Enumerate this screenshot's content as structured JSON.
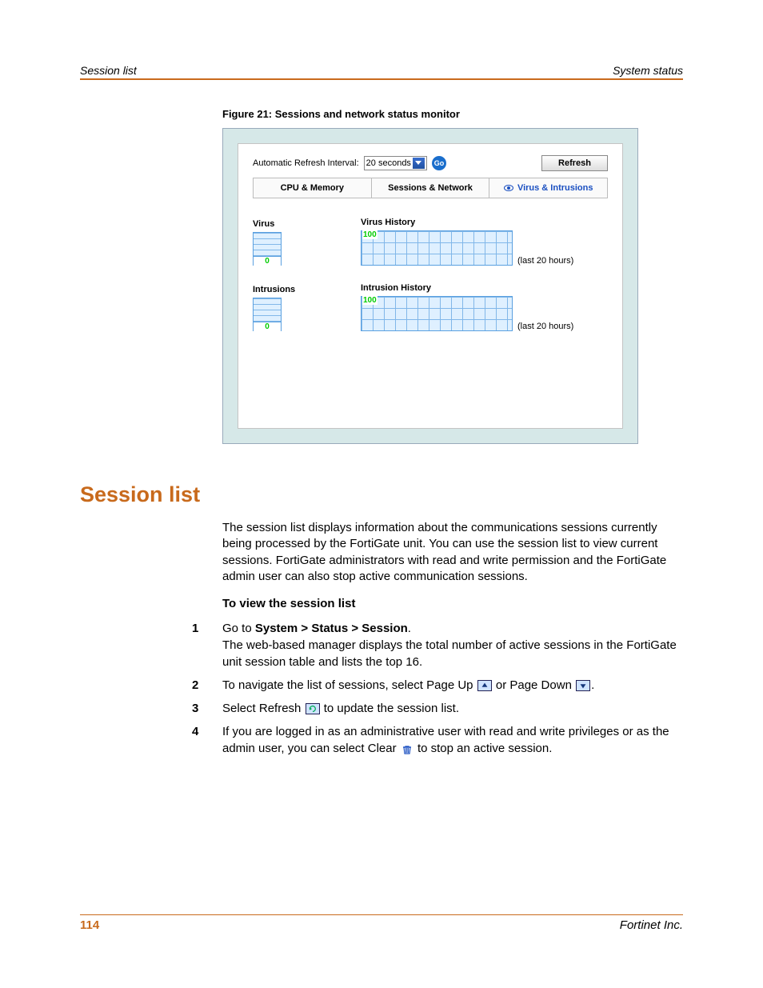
{
  "header": {
    "left": "Session list",
    "right": "System status"
  },
  "figure": {
    "caption": "Figure 21: Sessions and network status monitor"
  },
  "monitor": {
    "refresh_label": "Automatic Refresh Interval:",
    "refresh_value": "20 seconds",
    "go_label": "Go",
    "refresh_button": "Refresh",
    "tabs": {
      "cpu": "CPU & Memory",
      "sessions": "Sessions & Network",
      "virus": "Virus & Intrusions"
    },
    "virus": {
      "label": "Virus",
      "gauge_value": "0",
      "history_label": "Virus History",
      "history_ymax": "100",
      "history_caption": "(last 20 hours)"
    },
    "intrusions": {
      "label": "Intrusions",
      "gauge_value": "0",
      "history_label": "Intrusion History",
      "history_ymax": "100",
      "history_caption": "(last 20 hours)"
    }
  },
  "section": {
    "title": "Session list",
    "intro": "The session list displays information about the communications sessions currently being processed by the FortiGate unit. You can use the session list to view current sessions. FortiGate administrators with read and write permission and the FortiGate admin user can also stop active communication sessions.",
    "subhead": "To view the session list",
    "steps": {
      "s1a": "Go to ",
      "s1b": "System > Status > Session",
      "s1c": ".",
      "s1d": "The web-based manager displays the total number of active sessions in the FortiGate unit session table and lists the top 16.",
      "s2a": "To navigate the list of sessions, select Page Up ",
      "s2b": " or Page Down ",
      "s2c": ".",
      "s3a": "Select Refresh ",
      "s3b": " to update the session list.",
      "s4a": "If you are logged in as an administrative user with read and write privileges or as the admin user, you can select Clear ",
      "s4b": " to stop an active session."
    }
  },
  "footer": {
    "page": "114",
    "company": "Fortinet Inc."
  }
}
